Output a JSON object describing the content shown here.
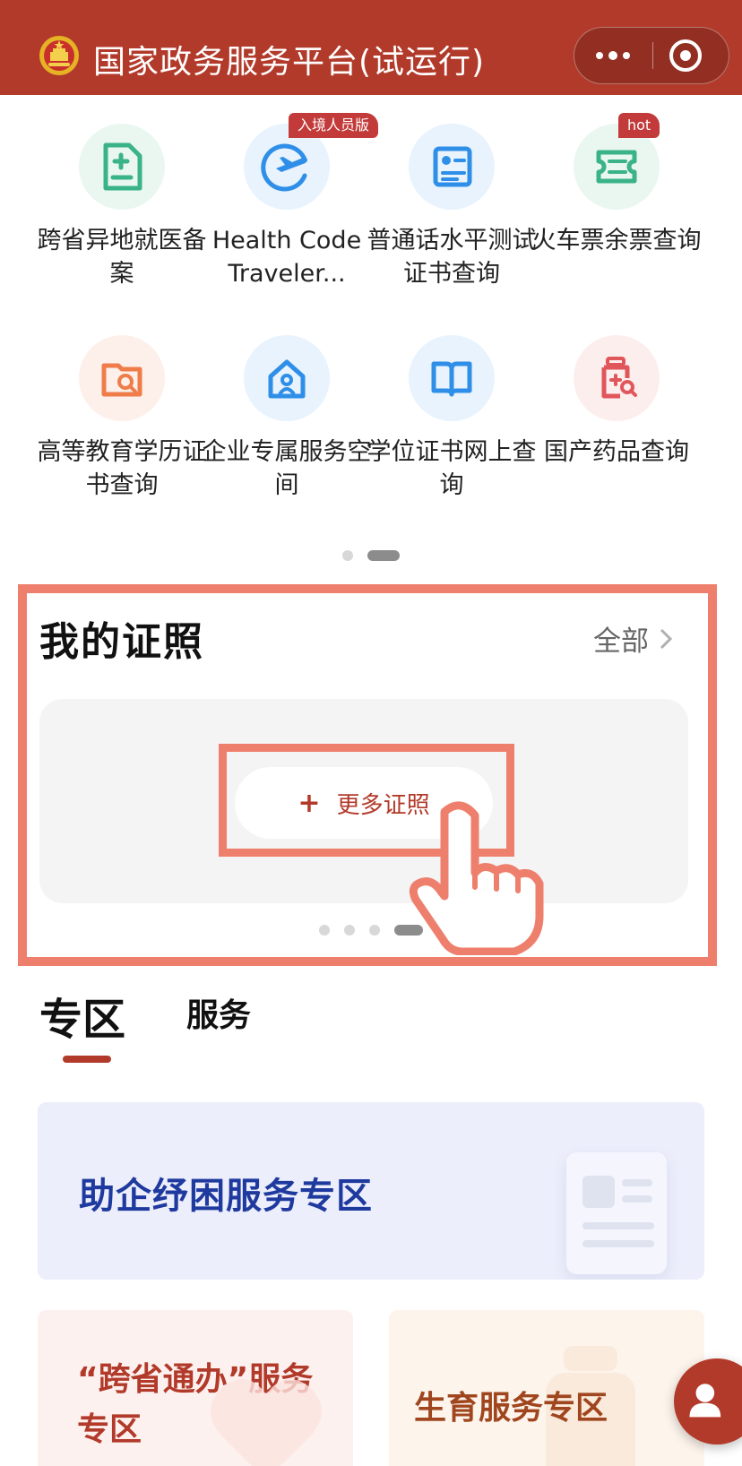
{
  "header": {
    "title": "国家政务服务平台(试运行)",
    "more_icon": "more-dots-icon",
    "close_icon": "close-circle-icon"
  },
  "services": [
    {
      "label": "跨省异地就医备案",
      "icon": "medical-record-icon",
      "color": "#3bb38a",
      "bg": "#eaf7f1"
    },
    {
      "label": "Health Code Traveler...",
      "icon": "airplane-icon",
      "color": "#2f8fe8",
      "bg": "#e8f3fd",
      "badge": "入境人员版"
    },
    {
      "label": "普通话水平测试证书查询",
      "icon": "certificate-icon",
      "color": "#2f8fe8",
      "bg": "#e8f3fd"
    },
    {
      "label": "火车票余票查询",
      "icon": "ticket-icon",
      "color": "#3bb38a",
      "bg": "#eaf7f1",
      "badge": "hot"
    },
    {
      "label": "高等教育学历证书查询",
      "icon": "education-search-icon",
      "color": "#ef7d4a",
      "bg": "#fdf0ea"
    },
    {
      "label": "企业专属服务空间",
      "icon": "home-user-icon",
      "color": "#2f8fe8",
      "bg": "#e8f3fd"
    },
    {
      "label": "学位证书网上查询",
      "icon": "book-icon",
      "color": "#2f8fe8",
      "bg": "#e8f3fd"
    },
    {
      "label": "国产药品查询",
      "icon": "medicine-search-icon",
      "color": "#e0565b",
      "bg": "#fdeeee"
    }
  ],
  "licenses": {
    "title": "我的证照",
    "all_label": "全部",
    "more_button": "更多证照",
    "plus": "+"
  },
  "tabs": [
    {
      "label": "专区",
      "active": true
    },
    {
      "label": "服务",
      "active": false
    }
  ],
  "zones": {
    "big": "助企纾困服务专区",
    "a": "“跨省通办”服务专区",
    "b": "生育服务专区"
  },
  "colors": {
    "brand": "#b23a2a",
    "highlight": "#ee7f6c",
    "zone_blue": "#1f3a9e"
  }
}
